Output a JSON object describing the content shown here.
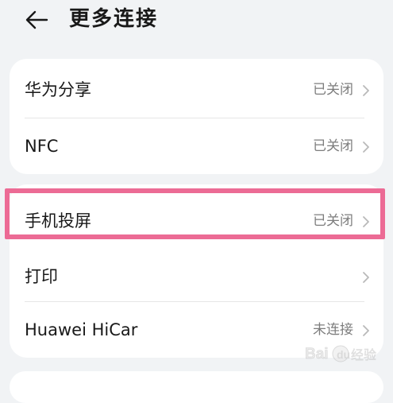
{
  "header": {
    "title": "更多连接",
    "back_icon": "arrow-left-icon"
  },
  "card1": {
    "items": [
      {
        "label": "华为分享",
        "status": "已关闭"
      },
      {
        "label": "NFC",
        "status": "已关闭"
      }
    ]
  },
  "card2": {
    "items": [
      {
        "label": "手机投屏",
        "status": "已关闭"
      },
      {
        "label": "打印",
        "status": ""
      },
      {
        "label": "Huawei HiCar",
        "status": "未连接"
      }
    ]
  },
  "colors": {
    "background": "#f1f3f5",
    "card": "#ffffff",
    "highlight": "#ec6b95",
    "secondary_text": "#7d7d7d"
  },
  "watermark": {
    "text": "Bai 经验"
  }
}
